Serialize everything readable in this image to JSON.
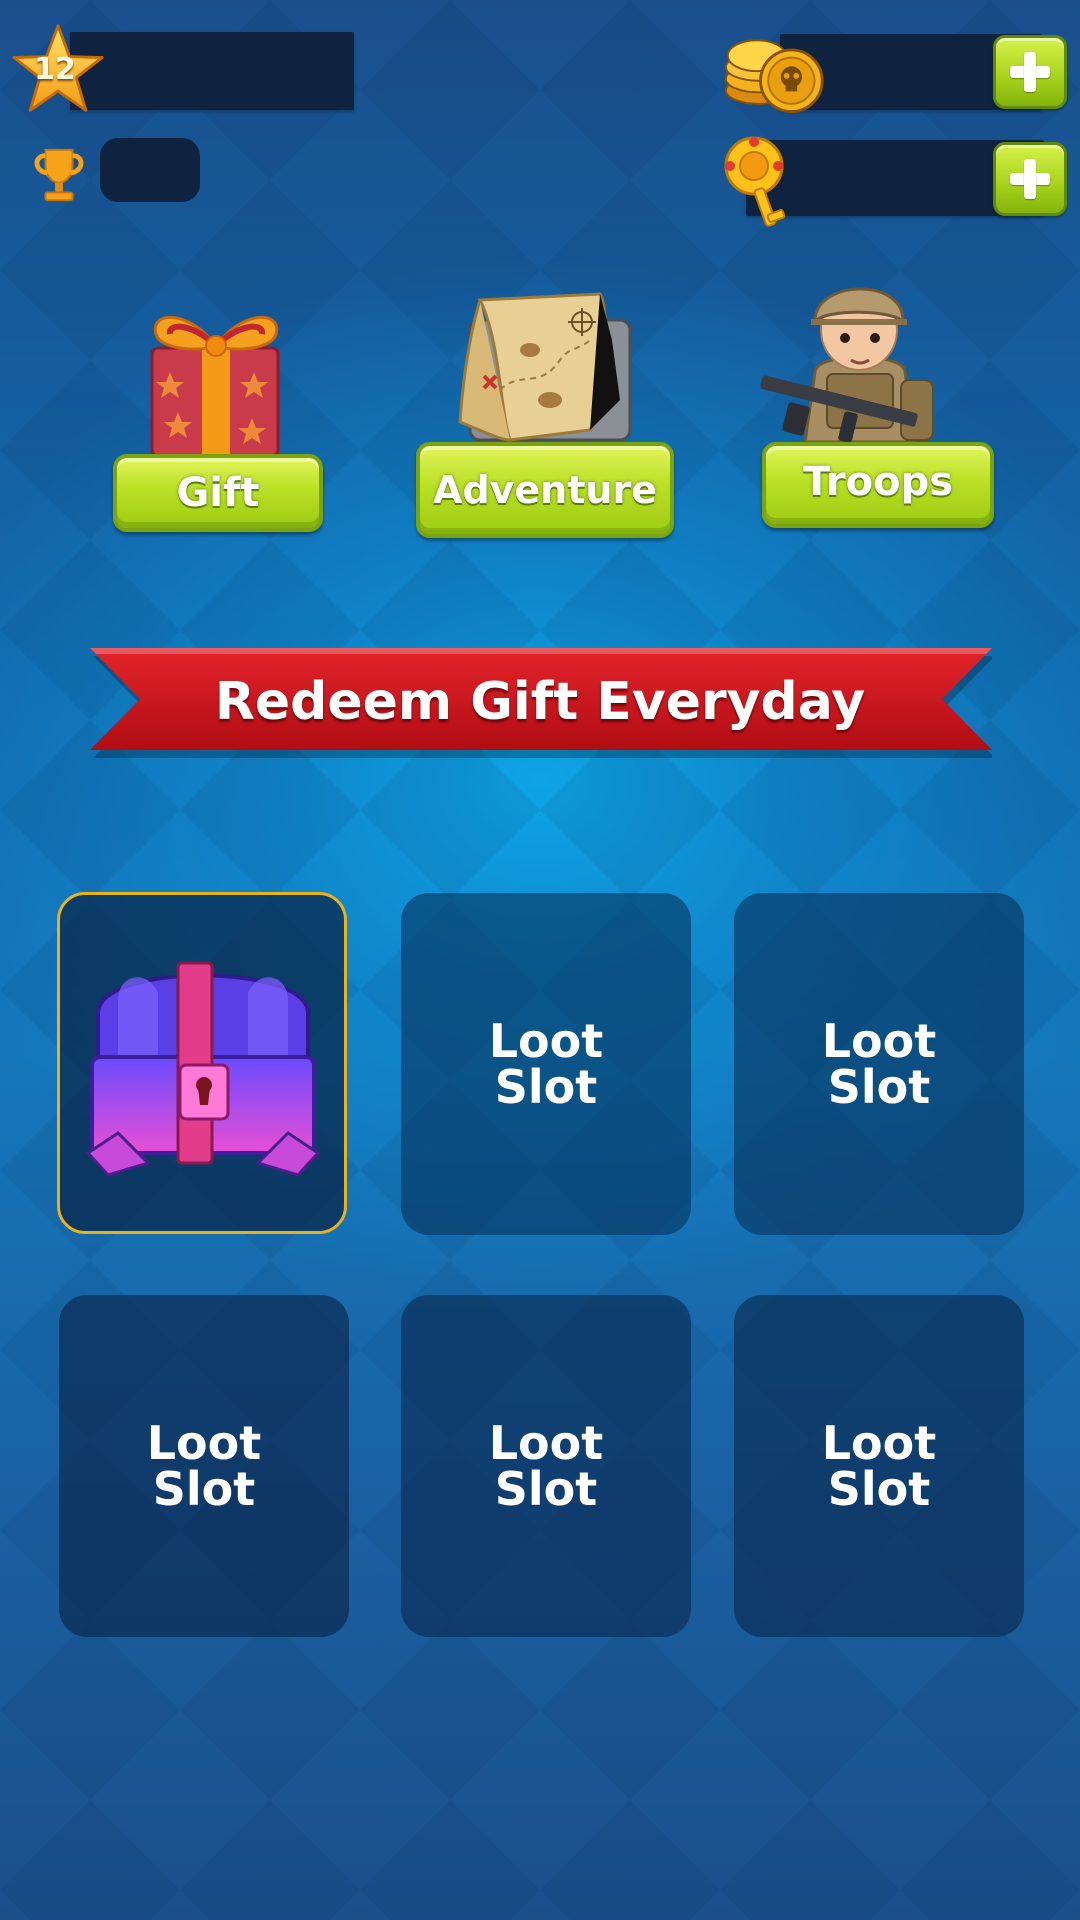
{
  "hud": {
    "level": "12",
    "level_icon": "star-icon",
    "trophy_icon": "trophy-icon",
    "currencies": [
      {
        "icon": "skull-coin-icon",
        "plus_icon": "plus-icon"
      },
      {
        "icon": "key-icon",
        "plus_icon": "plus-icon"
      }
    ]
  },
  "menu": {
    "items": [
      {
        "label": "Gift",
        "icon": "gift-box-icon"
      },
      {
        "label": "Adventure",
        "icon": "treasure-map-icon"
      },
      {
        "label": "Troops",
        "icon": "soldier-icon"
      }
    ]
  },
  "banner": {
    "text": "Redeem Gift Everyday"
  },
  "loot": {
    "slots": [
      {
        "state": "chest",
        "icon": "treasure-chest-icon",
        "label": ""
      },
      {
        "state": "empty",
        "label": "Loot\nSlot"
      },
      {
        "state": "empty",
        "label": "Loot\nSlot"
      },
      {
        "state": "empty",
        "label": "Loot\nSlot"
      },
      {
        "state": "empty",
        "label": "Loot\nSlot"
      },
      {
        "state": "empty",
        "label": "Loot\nSlot"
      }
    ]
  },
  "colors": {
    "button_green": "#b9e025",
    "ribbon_red": "#d3141c",
    "slot_highlight": "#e9b21a",
    "panel_dark": "#0f2340"
  }
}
